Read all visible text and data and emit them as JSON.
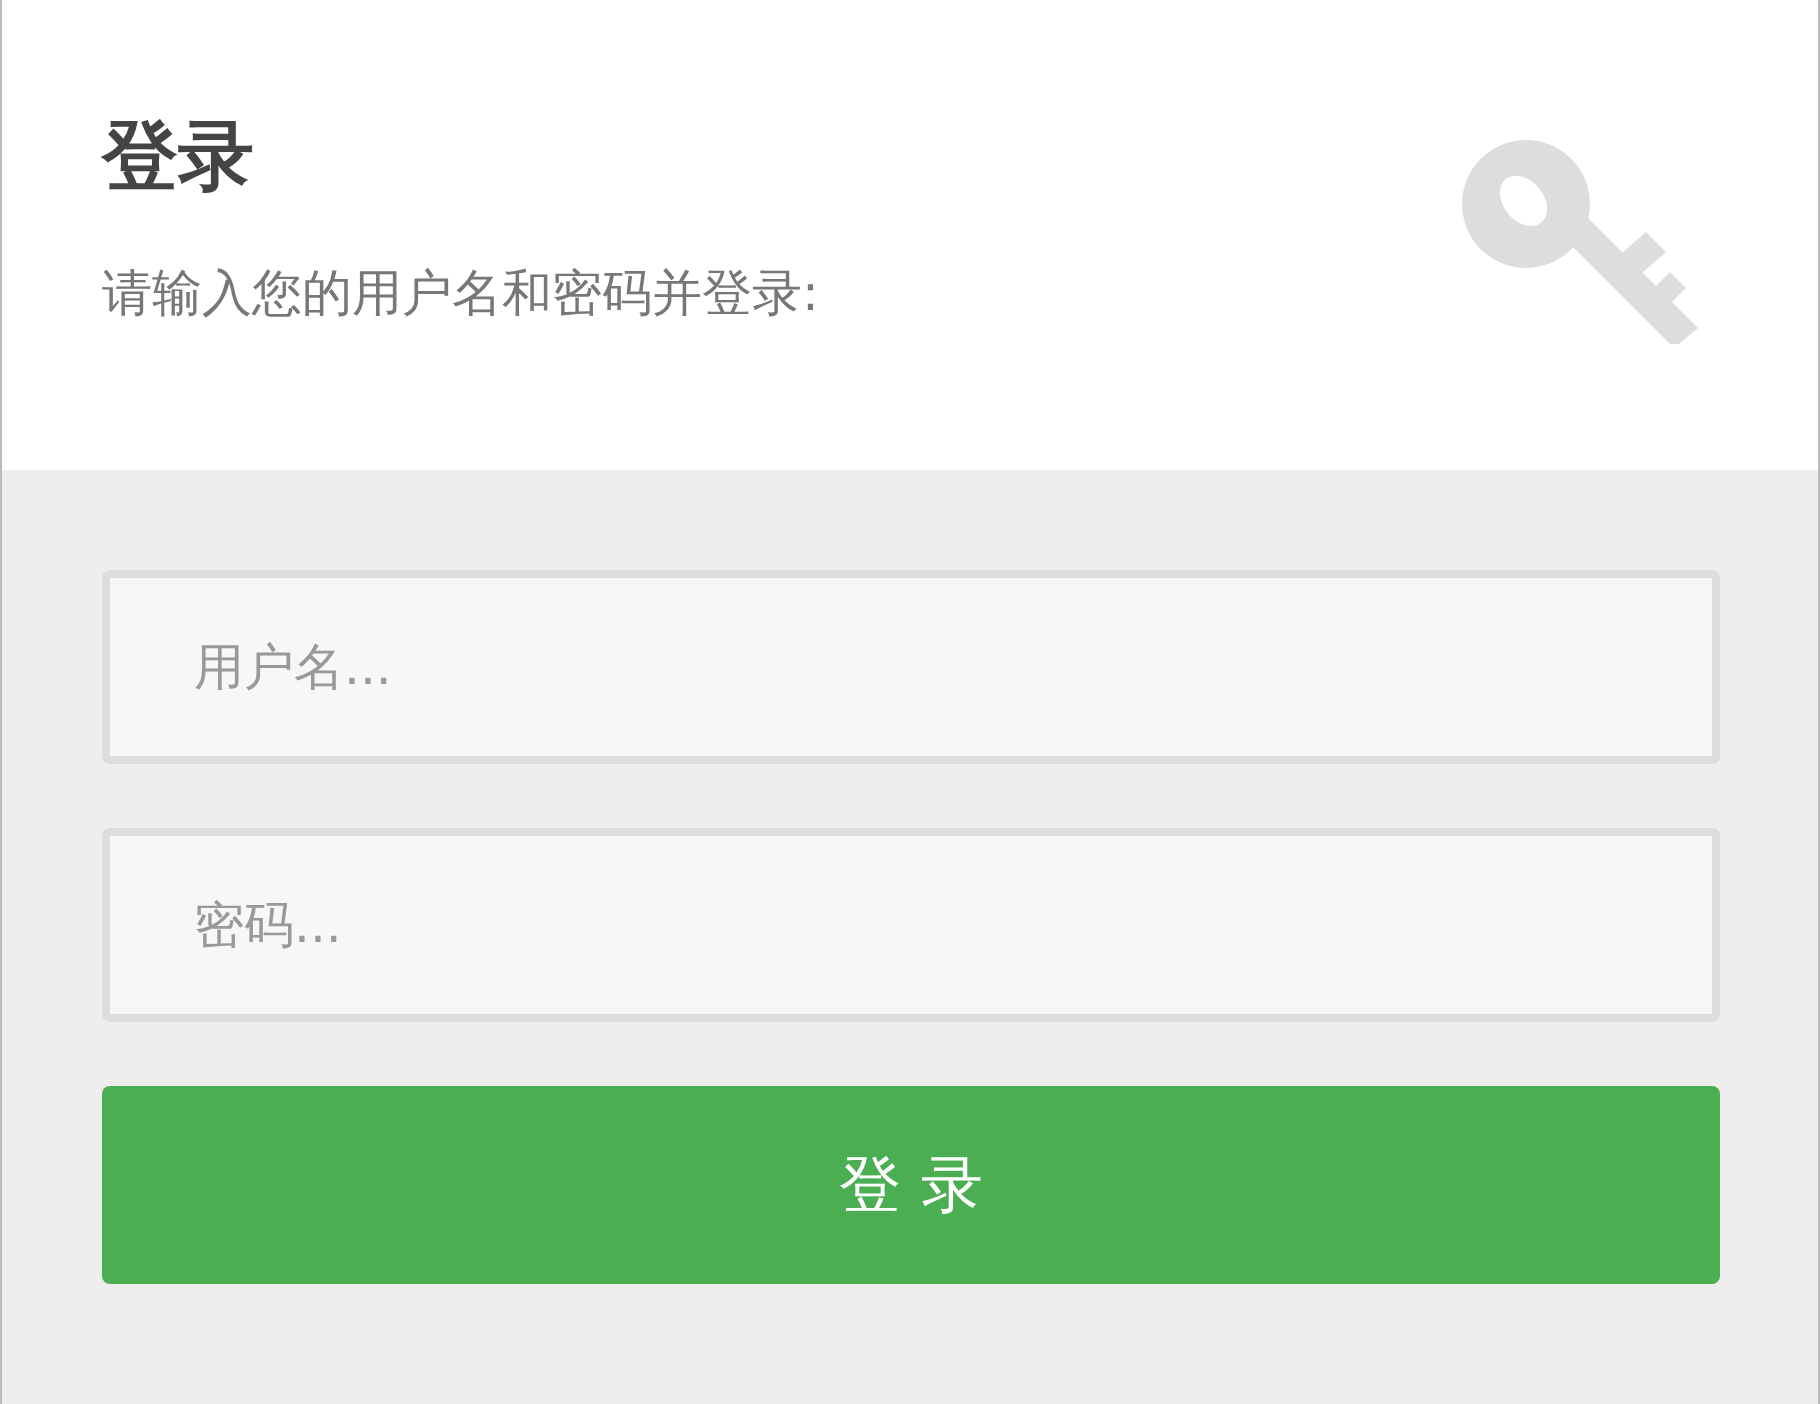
{
  "header": {
    "title": "登录",
    "subtitle": "请输入您的用户名和密码并登录:"
  },
  "form": {
    "username": {
      "placeholder": "用户名..."
    },
    "password": {
      "placeholder": "密码..."
    },
    "submit": "登 录"
  }
}
